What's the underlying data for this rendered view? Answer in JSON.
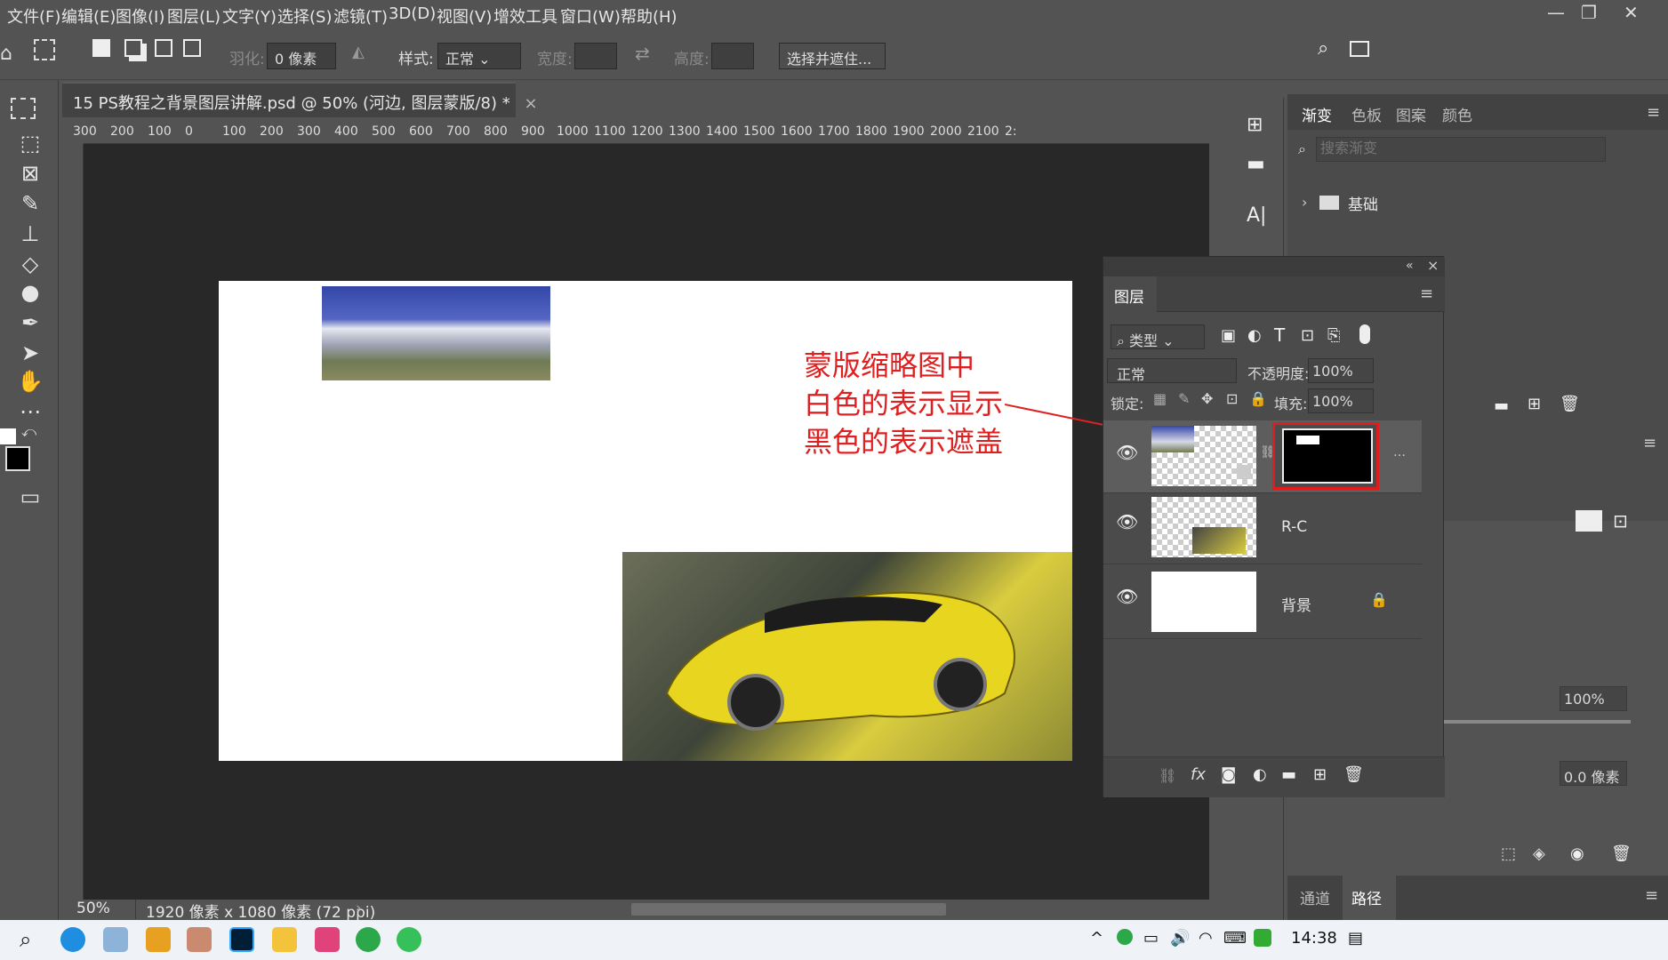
{
  "menubar": {
    "items": [
      "文件(F)",
      "编辑(E)",
      "图像(I)",
      "图层(L)",
      "文字(Y)",
      "选择(S)",
      "滤镜(T)",
      "3D(D)",
      "视图(V)",
      "增效工具",
      "窗口(W)",
      "帮助(H)"
    ]
  },
  "options": {
    "feather_label": "羽化:",
    "feather_value": "0 像素",
    "style_label": "样式:",
    "style_value": "正常",
    "width_label": "宽度:",
    "height_label": "高度:",
    "select_mask": "选择并遮住..."
  },
  "document": {
    "tab_title": "15 PS教程之背景图层讲解.psd @ 50% (河边, 图层蒙版/8) *",
    "zoom": "50%",
    "size_info": "1920 像素 x 1080 像素 (72 ppi)"
  },
  "ruler": {
    "ticks": [
      "300",
      "200",
      "100",
      "0",
      "100",
      "200",
      "300",
      "400",
      "500",
      "600",
      "700",
      "800",
      "900",
      "1000",
      "1100",
      "1200",
      "1300",
      "1400",
      "1500",
      "1600",
      "1700",
      "1800",
      "1900",
      "2000",
      "2100",
      "2:"
    ]
  },
  "annotation": {
    "line1": "蒙版缩略图中",
    "line2": "白色的表示显示",
    "line3": "黑色的表示遮盖"
  },
  "layers": {
    "title": "图层",
    "filter": "类型",
    "blend": "正常",
    "opacity_label": "不透明度:",
    "opacity": "100%",
    "lock_label": "锁定:",
    "fill_label": "填充:",
    "fill": "100%",
    "items": [
      {
        "name": ""
      },
      {
        "name": "R-C"
      },
      {
        "name": "背景"
      }
    ]
  },
  "gradient": {
    "tabs": [
      "渐变",
      "色板",
      "图案",
      "颜色"
    ],
    "search_placeholder": "搜索渐变",
    "folder": "基础"
  },
  "properties": {
    "density": "100%",
    "feather": "0.0 像素"
  },
  "bottom_tabs": {
    "channels": "通道",
    "paths": "路径"
  },
  "taskbar": {
    "time": "14:38"
  }
}
